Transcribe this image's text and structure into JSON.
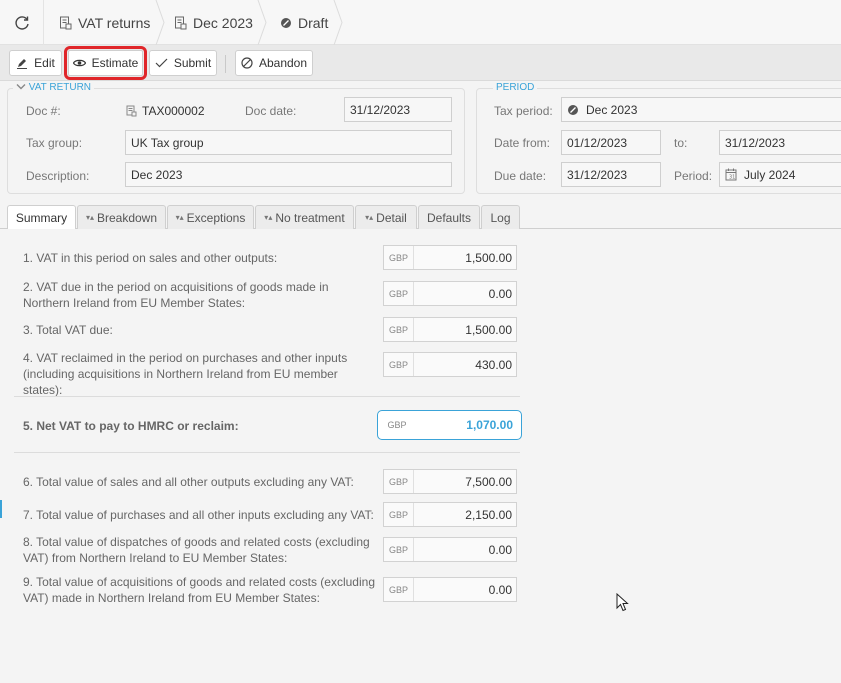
{
  "breadcrumb": {
    "items": [
      "VAT returns",
      "Dec 2023",
      "Draft"
    ]
  },
  "toolbar": {
    "edit": "Edit",
    "estimate": "Estimate",
    "submit": "Submit",
    "abandon": "Abandon"
  },
  "vat_return": {
    "legend": "VAT RETURN",
    "doc_no_label": "Doc #:",
    "doc_no": "TAX000002",
    "doc_date_label": "Doc date:",
    "doc_date": "31/12/2023",
    "tax_group_label": "Tax group:",
    "tax_group": "UK Tax group",
    "description_label": "Description:",
    "description": "Dec 2023"
  },
  "period": {
    "legend": "PERIOD",
    "tax_period_label": "Tax period:",
    "tax_period": "Dec 2023",
    "date_from_label": "Date from:",
    "date_from": "01/12/2023",
    "to_label": "to:",
    "date_to": "31/12/2023",
    "due_date_label": "Due date:",
    "due_date": "31/12/2023",
    "period_label": "Period:",
    "period_value": "July 2024"
  },
  "tabs": [
    "Summary",
    "Breakdown",
    "Exceptions",
    "No treatment",
    "Detail",
    "Defaults",
    "Log"
  ],
  "summary": {
    "currency": "GBP",
    "lines": [
      {
        "label": "1. VAT in this period on sales and other outputs:",
        "value": "1,500.00"
      },
      {
        "label": "2. VAT due in the period on acquisitions of goods made in Northern Ireland from EU Member States:",
        "value": "0.00"
      },
      {
        "label": "3. Total VAT due:",
        "value": "1,500.00"
      },
      {
        "label": "4. VAT reclaimed in the period on purchases and other inputs (including acquisitions in Northern Ireland from EU member states):",
        "value": "430.00"
      },
      {
        "label": "5. Net VAT to pay to HMRC or reclaim:",
        "value": "1,070.00"
      },
      {
        "label": "6. Total value of sales and all other outputs excluding any VAT:",
        "value": "7,500.00"
      },
      {
        "label": "7. Total value of purchases and all other inputs excluding any VAT:",
        "value": "2,150.00"
      },
      {
        "label": "8. Total value of dispatches of goods and related costs (excluding VAT) from Northern Ireland to EU Member States:",
        "value": "0.00"
      },
      {
        "label": "9. Total value of acquisitions of goods and related costs (excluding VAT) made in Northern Ireland from EU Member States:",
        "value": "0.00"
      }
    ]
  },
  "colors": {
    "accent": "#3aa3d8",
    "highlight": "#e0262a"
  }
}
